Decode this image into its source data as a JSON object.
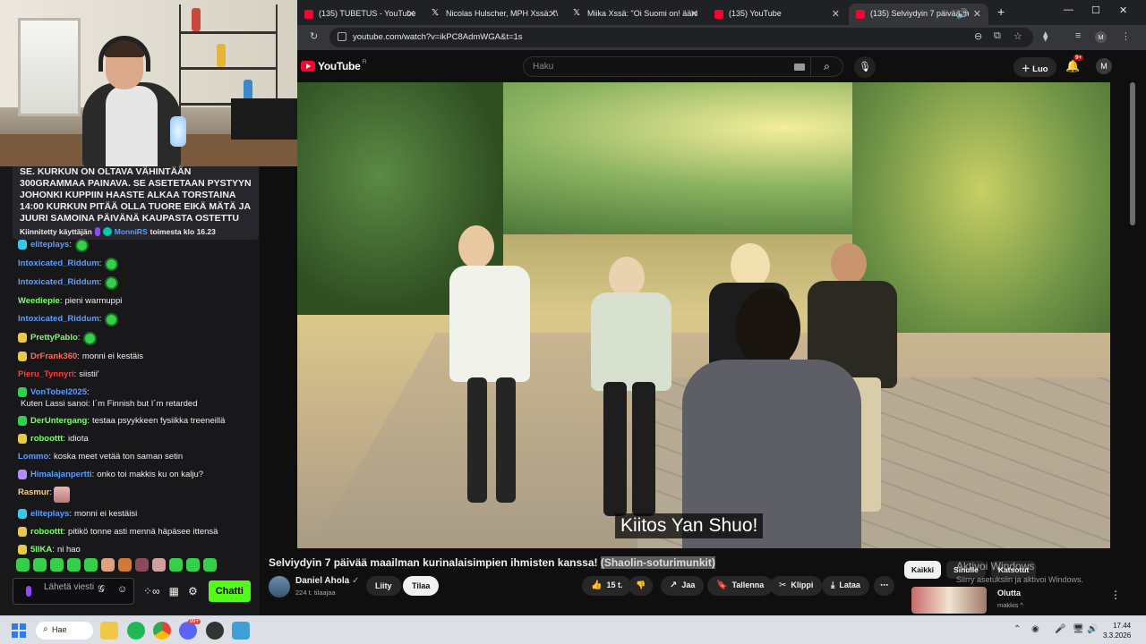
{
  "colors": {
    "twitch_purple": "#9147ff",
    "kick_green": "#53fc18",
    "yt_red": "#ff0033",
    "chat_bg": "#18181b",
    "yt_bg": "#0f0f0f"
  },
  "chat": {
    "pinned_text": "se. kurkun on oltava vähintään 300grammaa painava. se asetetaan pystyyn johonki kuppiin HAASTE ALKAA TORSTAINA 14:00 KURKUN PITÄÄ OLLA TUORE EIKÄ MÄTÄ JA JUURI SAMOINA PÄIVÄNÄ KAUPASTA OSTETTU",
    "pinned_by": "Kiinnitetty käyttäjän",
    "pinned_user": "MonniRS",
    "pinned_when": "toimesta klo 16.23",
    "messages": [
      {
        "user": "eliteplays",
        "color": "#5c9dff",
        "text": "",
        "badge": "#35c9e6",
        "emote": true
      },
      {
        "user": "Intoxicated_Riddum",
        "color": "#5c9dff",
        "text": "",
        "badge": "",
        "emote": true
      },
      {
        "user": "Intoxicated_Riddum",
        "color": "#5c9dff",
        "text": "",
        "badge": "",
        "emote": true
      },
      {
        "user": "Weediepie",
        "color": "#7cff6b",
        "text": "pieni warmuppi",
        "badge": "",
        "emote": false
      },
      {
        "user": "Intoxicated_Riddum",
        "color": "#5c9dff",
        "text": "",
        "badge": "",
        "emote": true
      },
      {
        "user": "PrettyPablo",
        "color": "#7cff6b",
        "text": "",
        "badge": "#e9c84a",
        "emote": true
      },
      {
        "user": "DrFrank360",
        "color": "#ff6b57",
        "text": "monni ei kestäis",
        "badge": "#e9c84a",
        "emote": false
      },
      {
        "user": "Pieru_Tynnyri",
        "color": "#ff3b3b",
        "text": "siistii'",
        "badge": "",
        "emote": false
      },
      {
        "user": "VonTobel2025",
        "color": "#5c9dff",
        "text": "Kuten Lassi sanoi: I´m Finnish but I´m retarded",
        "badge": "#35d04a",
        "emote": false
      },
      {
        "user": "DerUntergang",
        "color": "#7cff6b",
        "text": "testaa psyykkeen fysiikka treeneillä",
        "badge": "#35d04a",
        "emote": false
      },
      {
        "user": "roboottt",
        "color": "#7cff6b",
        "text": "idiota",
        "badge": "#e9c84a",
        "emote": false
      },
      {
        "user": "Lommo",
        "color": "#5c9dff",
        "text": "koska meet vetää ton saman setin",
        "badge": "",
        "emote": false
      },
      {
        "user": "Himalajanpertti",
        "color": "#5c9dff",
        "text": "onko toi makkis ku on kalju?",
        "badge": "#b08cff",
        "emote": false
      },
      {
        "user": "Rasmur",
        "color": "#f5d08a",
        "text": "",
        "badge": "",
        "emote_img": true
      },
      {
        "user": "eliteplays",
        "color": "#5c9dff",
        "text": "monni ei kestäisi",
        "badge": "#35c9e6",
        "emote": false
      },
      {
        "user": "roboottt",
        "color": "#7cff6b",
        "text": "pitikö tonne asti mennä häpäsee ittensä",
        "badge": "#e9c84a",
        "emote": false
      },
      {
        "user": "5IIKA",
        "color": "#7cff6b",
        "text": "ni hao",
        "badge": "#e9c84a",
        "emote": false
      }
    ],
    "input_placeholder": "Lähetä viesti",
    "send_label": "Chatti"
  },
  "browser": {
    "tabs": [
      {
        "title": "(135) TUBETUS - YouTube",
        "fav": "#ff0033"
      },
      {
        "title": "Nicolas Hulscher, MPH Xssä: \"\\",
        "fav": "#ffffff"
      },
      {
        "title": "Miika Xssä: \"Oi Suomi on! ääni",
        "fav": "#ffffff"
      },
      {
        "title": "(135) YouTube",
        "fav": "#ff0033"
      },
      {
        "title": "(135) Selviydyin 7 päivää m",
        "fav": "#ff0033"
      }
    ],
    "url": "youtube.com/watch?v=ikPC8AdmWGA&t=1s",
    "profile_initial": "M"
  },
  "youtube": {
    "logo_text": "YouTube",
    "region": "FI",
    "search_placeholder": "Haku",
    "create_label": "Luo",
    "notif_count": "9+",
    "avatar_initial": "M",
    "subtitle": "Kiitos Yan Shuo!",
    "video_title": "Selviydyin 7 päivää maailman kurinalaisimpien ihmisten kanssa!",
    "video_title_highlight": "(Shaolin-soturimunkit)",
    "channel_name": "Daniel Ahola",
    "subscribers": "224 t. tilaajaa",
    "join_label": "Liity",
    "subscribe_label": "Tilaa",
    "likes": "15 t.",
    "share_label": "Jaa",
    "save_label": "Tallenna",
    "clip_label": "Klippi",
    "download_label": "Lataa",
    "chips": [
      "Kaikki",
      "Sinulle",
      "Katsotut"
    ],
    "watermark_title": "Aktivoi Windows",
    "watermark_sub": "Siirry asetuksiin ja aktivoi Windows.",
    "rec_title": "Olutta",
    "rec_channel": "makkis ^"
  },
  "taskbar": {
    "search_label": "Hae",
    "discord_badge": "99+",
    "time": "17.44",
    "date": "3.3.2026"
  }
}
